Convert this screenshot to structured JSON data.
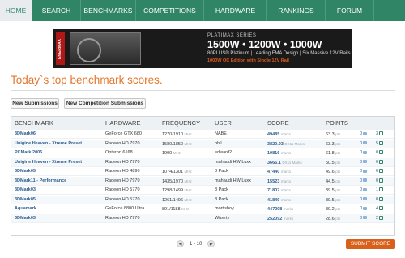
{
  "nav": [
    {
      "label": "HOME",
      "active": true
    },
    {
      "label": "SEARCH"
    },
    {
      "label": "BENCHMARKS"
    },
    {
      "label": "COMPETITIONS"
    },
    {
      "label": "HARDWARE"
    },
    {
      "label": "RANKINGS"
    },
    {
      "label": "FORUM"
    }
  ],
  "banner": {
    "logo": "ENERMAX",
    "series": "PLATIMAX SERIES",
    "watts": "1500W • 1200W • 1000W",
    "tagline": "80PLUS® Platinum | Leading FMA Design | Six Massive 12V Rails",
    "tagline2": "1000W OC Edition with Single 12V Rail"
  },
  "heading": "Today`s top benchmark scores.",
  "tabs": {
    "new_submissions": "New Submissions",
    "new_competition": "New Competition Submissions"
  },
  "table": {
    "headers": {
      "benchmark": "BENCHMARK",
      "hardware": "HARDWARE",
      "frequency": "FREQUENCY",
      "user": "USER",
      "score": "SCORE",
      "points": "POINTS"
    },
    "rows": [
      {
        "benchmark": "3DMark06",
        "hardware": "GeForce GTX 680",
        "freq": "1270/1910",
        "freq_unit": "MHz",
        "user": "NABE",
        "score": "49485",
        "score_unit": "marks",
        "points": "63.3",
        "points_unit": "pts",
        "comments": "0",
        "likes": "3"
      },
      {
        "benchmark": "Unigine Heaven - Xtreme Preset",
        "hardware": "Radeon HD 7970",
        "freq": "1580/1850",
        "freq_unit": "MHz",
        "user": "phil",
        "score": "3820.93",
        "score_unit": "DX11 Marks",
        "points": "63.3",
        "points_unit": "pts",
        "comments": "0",
        "likes": "5"
      },
      {
        "benchmark": "PCMark 2005",
        "hardware": "Opteron 6168",
        "freq": "1900",
        "freq_unit": "MHz",
        "user": "edward2",
        "score": "10816",
        "score_unit": "marks",
        "points": "61.8",
        "points_unit": "pts",
        "comments": "0",
        "likes": "0"
      },
      {
        "benchmark": "Unigine Heaven - Xtreme Preset",
        "hardware": "Radeon HD 7970",
        "freq": "",
        "freq_unit": "",
        "user": "mahaudi HW Luxx",
        "score": "3666.1",
        "score_unit": "DX11 Marks",
        "points": "50.5",
        "points_unit": "pts",
        "comments": "0",
        "likes": "0"
      },
      {
        "benchmark": "3DMark05",
        "hardware": "Radeon HD 4890",
        "freq": "1074/1301",
        "freq_unit": "MHz",
        "user": "8 Pack",
        "score": "47440",
        "score_unit": "marks",
        "points": "49.6",
        "points_unit": "pts",
        "comments": "0",
        "likes": "0"
      },
      {
        "benchmark": "3DMark11 - Performance",
        "hardware": "Radeon HD 7970",
        "freq": "1435/1970",
        "freq_unit": "MHz",
        "user": "mahaudi HW Luxx",
        "score": "15523",
        "score_unit": "marks",
        "points": "44.5",
        "points_unit": "pts",
        "comments": "0",
        "likes": "0"
      },
      {
        "benchmark": "3DMark03",
        "hardware": "Radeon HD 5770",
        "freq": "1298/1499",
        "freq_unit": "MHz",
        "user": "8 Pack",
        "score": "71807",
        "score_unit": "marks",
        "points": "39.5",
        "points_unit": "pts",
        "comments": "0",
        "likes": "1"
      },
      {
        "benchmark": "3DMark05",
        "hardware": "Radeon HD 5770",
        "freq": "1261/1496",
        "freq_unit": "MHz",
        "user": "8 Pack",
        "score": "41849",
        "score_unit": "marks",
        "points": "39.5",
        "points_unit": "pts",
        "comments": "0",
        "likes": "0"
      },
      {
        "benchmark": "Aquamark",
        "hardware": "GeForce 8800 Ultra",
        "freq": "891/1188",
        "freq_unit": "MHz",
        "user": "mortisboy",
        "score": "447298",
        "score_unit": "marks",
        "points": "39.2",
        "points_unit": "pts",
        "comments": "0",
        "likes": "4"
      },
      {
        "benchmark": "3DMark03",
        "hardware": "Radeon HD 7970",
        "freq": "",
        "freq_unit": "",
        "user": "Wizerty",
        "score": "252092",
        "score_unit": "marks",
        "points": "28.6",
        "points_unit": "pts",
        "comments": "0",
        "likes": "2"
      }
    ]
  },
  "pager": {
    "prev": "◀",
    "label": "1 - 10",
    "next": "▶"
  },
  "submit_label": "SUBMIT SCORE"
}
